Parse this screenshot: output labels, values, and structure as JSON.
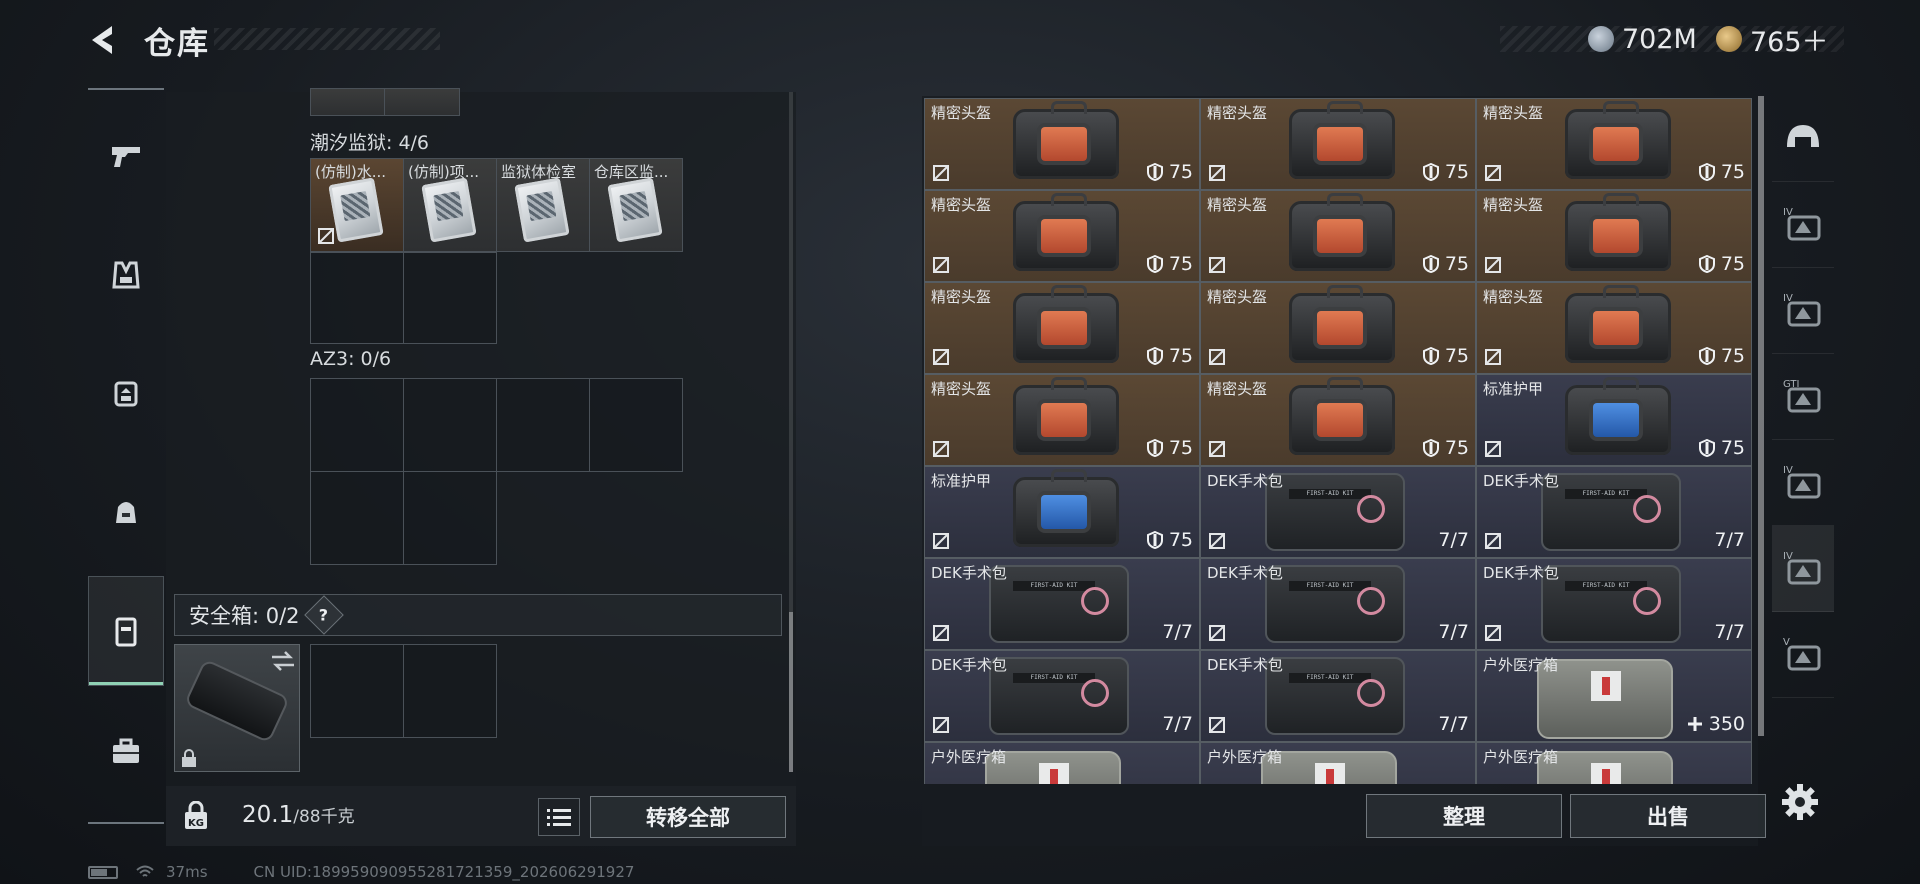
{
  "header": {
    "title": "仓库",
    "currencies": [
      {
        "icon": "silver-coin-icon",
        "value": "702M",
        "color": "#9aa6b2"
      },
      {
        "icon": "gold-coin-icon",
        "value": "765＋",
        "color": "#c8a155"
      }
    ]
  },
  "left_rail": {
    "items": [
      {
        "icon": "pistol-icon",
        "active": false
      },
      {
        "icon": "vest-icon",
        "active": false
      },
      {
        "icon": "backpack-rig-icon",
        "active": false
      },
      {
        "icon": "backpack-icon",
        "active": false
      },
      {
        "icon": "container-icon",
        "active": true
      },
      {
        "icon": "toolbox-icon",
        "active": false
      }
    ]
  },
  "storage": {
    "sections": [
      {
        "label": "潮汐监狱: 4/6",
        "items": [
          "(仿制)水...",
          "(仿制)项...",
          "监狱体检室",
          "仓库区监..."
        ]
      },
      {
        "label": "AZ3: 0/6",
        "items": []
      }
    ],
    "safe_box": {
      "label": "安全箱: 0/2",
      "help": "?"
    },
    "weight": {
      "current": "20.1",
      "max": "/88千克"
    },
    "transfer_all": "转移全部"
  },
  "inventory": {
    "items": [
      {
        "name": "精密头盔",
        "value": "75",
        "kind": "helmet",
        "theme": "brown"
      },
      {
        "name": "精密头盔",
        "value": "75",
        "kind": "helmet",
        "theme": "brown"
      },
      {
        "name": "精密头盔",
        "value": "75",
        "kind": "helmet",
        "theme": "brown"
      },
      {
        "name": "精密头盔",
        "value": "75",
        "kind": "helmet",
        "theme": "brown"
      },
      {
        "name": "精密头盔",
        "value": "75",
        "kind": "helmet",
        "theme": "brown"
      },
      {
        "name": "精密头盔",
        "value": "75",
        "kind": "helmet",
        "theme": "brown"
      },
      {
        "name": "精密头盔",
        "value": "75",
        "kind": "helmet",
        "theme": "brown"
      },
      {
        "name": "精密头盔",
        "value": "75",
        "kind": "helmet",
        "theme": "brown"
      },
      {
        "name": "精密头盔",
        "value": "75",
        "kind": "helmet",
        "theme": "brown"
      },
      {
        "name": "精密头盔",
        "value": "75",
        "kind": "helmet",
        "theme": "brown"
      },
      {
        "name": "精密头盔",
        "value": "75",
        "kind": "helmet",
        "theme": "brown"
      },
      {
        "name": "标准护甲",
        "value": "75",
        "kind": "armor",
        "theme": "blue"
      },
      {
        "name": "标准护甲",
        "value": "75",
        "kind": "armor",
        "theme": "blue"
      },
      {
        "name": "DEK手术包",
        "value": "7/7",
        "kind": "medkit",
        "theme": "blue"
      },
      {
        "name": "DEK手术包",
        "value": "7/7",
        "kind": "medkit",
        "theme": "blue"
      },
      {
        "name": "DEK手术包",
        "value": "7/7",
        "kind": "medkit",
        "theme": "blue"
      },
      {
        "name": "DEK手术包",
        "value": "7/7",
        "kind": "medkit",
        "theme": "blue"
      },
      {
        "name": "DEK手术包",
        "value": "7/7",
        "kind": "medkit",
        "theme": "blue"
      },
      {
        "name": "DEK手术包",
        "value": "7/7",
        "kind": "medkit",
        "theme": "blue"
      },
      {
        "name": "DEK手术包",
        "value": "7/7",
        "kind": "medkit",
        "theme": "blue"
      },
      {
        "name": "户外医疗箱",
        "value": "350",
        "kind": "outdoor",
        "theme": "blue"
      },
      {
        "name": "户外医疗箱",
        "value": "",
        "kind": "outdoor",
        "theme": "blue"
      },
      {
        "name": "户外医疗箱",
        "value": "",
        "kind": "outdoor",
        "theme": "blue"
      },
      {
        "name": "户外医疗箱",
        "value": "",
        "kind": "outdoor",
        "theme": "blue"
      }
    ],
    "sort": "整理",
    "sell": "出售"
  },
  "right_rail": {
    "items": [
      {
        "icon": "helmet-filter-icon",
        "badge": ""
      },
      {
        "icon": "armor-filter-icon",
        "badge": "IV"
      },
      {
        "icon": "armor-filter-icon",
        "badge": "IV"
      },
      {
        "icon": "rig-filter-icon",
        "badge": "GTI"
      },
      {
        "icon": "rig-filter-icon",
        "badge": "IV"
      },
      {
        "icon": "medkit-filter-icon",
        "badge": "IV"
      },
      {
        "icon": "misc-filter-icon",
        "badge": "V"
      }
    ]
  },
  "status": {
    "ping": "37ms",
    "uid": "CN UID:1899590909552817213​59_202606291927"
  }
}
